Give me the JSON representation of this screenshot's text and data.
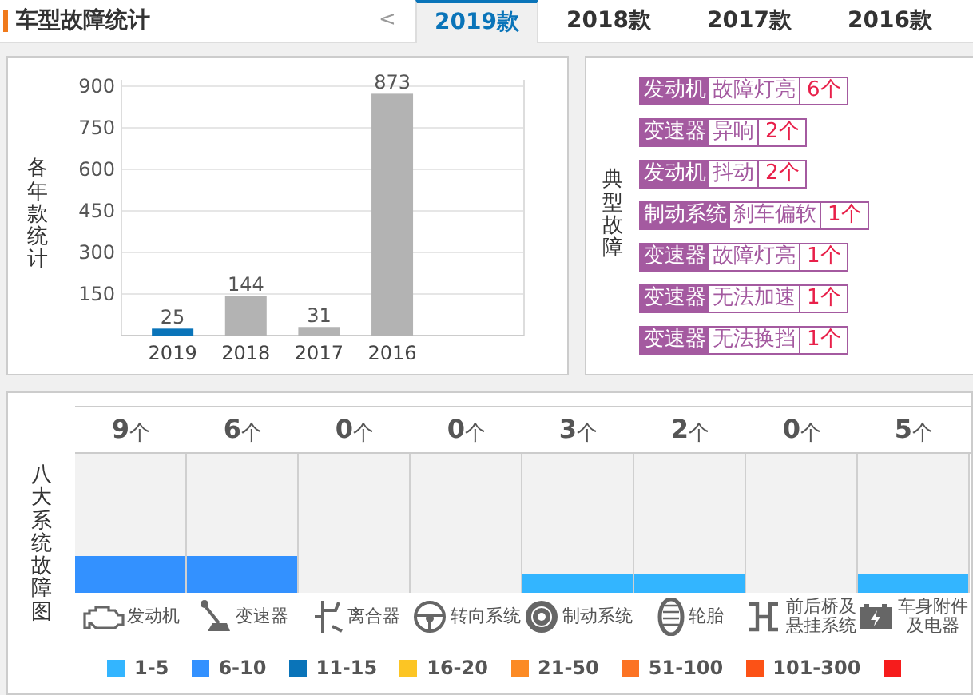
{
  "header": {
    "title": "车型故障统计",
    "prev": "<",
    "tabs": [
      {
        "label": "2019款",
        "selected": true
      },
      {
        "label": "2018款",
        "selected": false
      },
      {
        "label": "2017款",
        "selected": false
      },
      {
        "label": "2016款",
        "selected": false
      }
    ]
  },
  "year_panel": {
    "label": "各年款统计",
    "chart_data": {
      "type": "bar",
      "categories": [
        "2019",
        "2018",
        "2017",
        "2016"
      ],
      "series": [
        {
          "color": "#0a74b9",
          "values": [
            25,
            null,
            null,
            null
          ]
        },
        {
          "color": "#b3b3b3",
          "values": [
            null,
            144,
            31,
            873
          ]
        }
      ],
      "yticks": [
        150,
        300,
        450,
        600,
        750,
        900
      ],
      "ylim": [
        0,
        900
      ],
      "grid": true,
      "data_labels": true
    }
  },
  "fault_panel": {
    "label": "典型故障",
    "faults": [
      {
        "system": "发动机",
        "problem": "故障灯亮",
        "count": "6个"
      },
      {
        "system": "变速器",
        "problem": "异响",
        "count": "2个"
      },
      {
        "system": "发动机",
        "problem": "抖动",
        "count": "2个"
      },
      {
        "system": "制动系统",
        "problem": "刹车偏软",
        "count": "1个"
      },
      {
        "system": "变速器",
        "problem": "故障灯亮",
        "count": "1个"
      },
      {
        "system": "变速器",
        "problem": "无法加速",
        "count": "1个"
      },
      {
        "system": "变速器",
        "problem": "无法换挡",
        "count": "1个"
      }
    ]
  },
  "systems_panel": {
    "label": "八大系统故障图",
    "systems": [
      {
        "count": "9",
        "unit": "个",
        "level": 0.27,
        "color": "#3391ff",
        "kind": "engine",
        "name": "发动机"
      },
      {
        "count": "6",
        "unit": "个",
        "level": 0.27,
        "color": "#3391ff",
        "kind": "gearbox",
        "name": "变速器"
      },
      {
        "count": "0",
        "unit": "个",
        "kind": "clutch",
        "name": "离合器"
      },
      {
        "count": "0",
        "unit": "个",
        "kind": "steering",
        "name": "转向系统"
      },
      {
        "count": "3",
        "unit": "个",
        "level": 0.14,
        "color": "#33b5ff",
        "kind": "brake",
        "name": "制动系统"
      },
      {
        "count": "2",
        "unit": "个",
        "level": 0.14,
        "color": "#33b5ff",
        "kind": "tire",
        "name": "轮胎"
      },
      {
        "count": "0",
        "unit": "个",
        "kind": "axle",
        "name": "前后桥及悬挂系统"
      },
      {
        "count": "5",
        "unit": "个",
        "level": 0.14,
        "color": "#33b5ff",
        "kind": "battery",
        "name": "车身附件及电器"
      }
    ],
    "legend": [
      {
        "label": "1-5",
        "color": "#33b5ff"
      },
      {
        "label": "6-10",
        "color": "#3391ff"
      },
      {
        "label": "11-15",
        "color": "#0a74b9"
      },
      {
        "label": "16-20",
        "color": "#fcc524"
      },
      {
        "label": "21-50",
        "color": "#fc8a24"
      },
      {
        "label": "51-100",
        "color": "#fc7324"
      },
      {
        "label": "101-300",
        "color": "#fc5216"
      },
      {
        "color": "#f61c1c"
      }
    ]
  }
}
